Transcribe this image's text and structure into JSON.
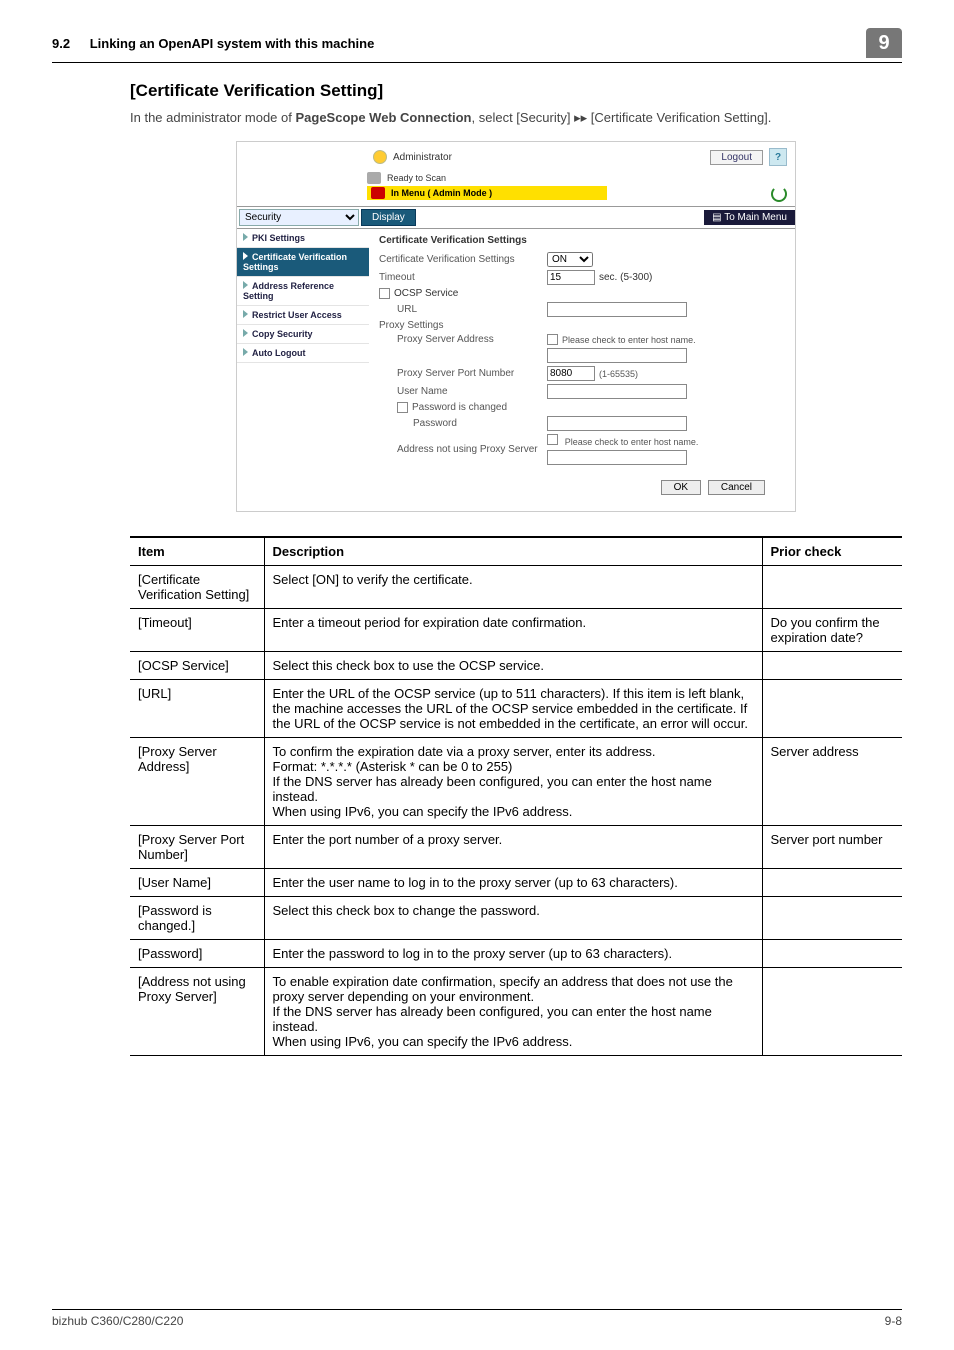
{
  "runhead": {
    "section_num": "9.2",
    "section_title": "Linking an OpenAPI system with this machine",
    "chapter": "9"
  },
  "heading": "[Certificate Verification Setting]",
  "intro_parts": {
    "p1": "In the administrator mode of ",
    "bold1": "PageScope Web Connection",
    "p2": ", select [Security] ",
    "arrow": "▸▸",
    "p3": " [Certificate Verification Setting]."
  },
  "screenshot": {
    "admin_label": "Administrator",
    "logout": "Logout",
    "help": "?",
    "status_ready": "Ready to Scan",
    "status_mode": "In Menu ( Admin Mode )",
    "category": "Security",
    "display_btn": "Display",
    "to_main": "To Main Menu",
    "sidebar": [
      {
        "label": "PKI Settings",
        "active": false
      },
      {
        "label": "Certificate Verification Settings",
        "active": true
      },
      {
        "label": "Address Reference Setting",
        "active": false
      },
      {
        "label": "Restrict User Access",
        "active": false
      },
      {
        "label": "Copy Security",
        "active": false
      },
      {
        "label": "Auto Logout",
        "active": false
      }
    ],
    "main_title": "Certificate Verification Settings",
    "rows": {
      "cvs": {
        "label": "Certificate Verification Settings",
        "value": "ON"
      },
      "timeout": {
        "label": "Timeout",
        "value": "15",
        "suffix": "sec. (5-300)"
      },
      "ocsp": {
        "label": "OCSP Service"
      },
      "url": {
        "label": "URL"
      },
      "proxy_header": "Proxy Settings",
      "proxy_addr": {
        "label": "Proxy Server Address",
        "note": "Please check to enter host name."
      },
      "proxy_port": {
        "label": "Proxy Server Port Number",
        "value": "8080",
        "suffix": "(1-65535)"
      },
      "user": {
        "label": "User Name"
      },
      "pwd_chg": {
        "label": "Password is changed"
      },
      "pwd": {
        "label": "Password"
      },
      "addr_not": {
        "label": "Address not using Proxy Server",
        "note": "Please check to enter host name."
      }
    },
    "ok": "OK",
    "cancel": "Cancel"
  },
  "table": {
    "headers": {
      "item": "Item",
      "desc": "Description",
      "prior": "Prior check"
    },
    "rows": [
      {
        "item": "[Certificate Verification Setting]",
        "desc": "Select [ON] to verify the certificate.",
        "prior": ""
      },
      {
        "item": "[Timeout]",
        "desc": "Enter a timeout period for expiration date confirmation.",
        "prior": "Do you confirm the expiration date?"
      },
      {
        "item": "[OCSP Service]",
        "desc": "Select this check box to use the OCSP service.",
        "prior": ""
      },
      {
        "item": "[URL]",
        "desc": "Enter the URL of the OCSP service (up to 511 characters). If this item is left blank, the machine accesses the URL of the OCSP service embedded in the certificate. If the URL of the OCSP service is not embedded in the certificate, an error will occur.",
        "prior": ""
      },
      {
        "item": "[Proxy Server Address]",
        "desc": "To confirm the expiration date via a proxy server, enter its address.\nFormat: *.*.*.* (Asterisk * can be 0 to 255)\nIf the DNS server has already been configured, you can enter the host name instead.\nWhen using IPv6, you can specify the IPv6 address.",
        "prior": "Server address"
      },
      {
        "item": "[Proxy Server Port Number]",
        "desc": "Enter the port number of a proxy server.",
        "prior": "Server port number"
      },
      {
        "item": "[User Name]",
        "desc": "Enter the user name to log in to the proxy server (up to 63 characters).",
        "prior": ""
      },
      {
        "item": "[Password is changed.]",
        "desc": "Select this check box to change the password.",
        "prior": ""
      },
      {
        "item": "[Password]",
        "desc": "Enter the password to log in to the proxy server (up to 63 characters).",
        "prior": ""
      },
      {
        "item": "[Address not using Proxy Server]",
        "desc": "To enable expiration date confirmation, specify an address that does not use the proxy server depending on your environment.\nIf the DNS server has already been configured, you can enter the host name instead.\nWhen using IPv6, you can specify the IPv6 address.",
        "prior": ""
      }
    ]
  },
  "footer": {
    "left": "bizhub C360/C280/C220",
    "right": "9-8"
  }
}
